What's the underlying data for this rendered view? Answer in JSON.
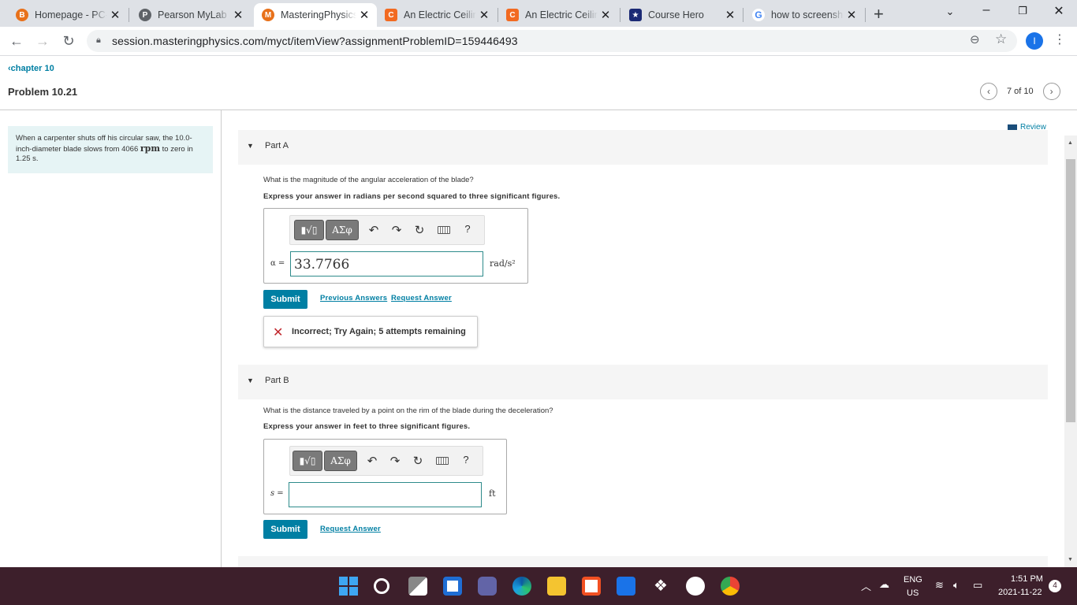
{
  "browser": {
    "tabs": [
      {
        "title": "Homepage - PC-",
        "favicon": "B",
        "favicon_color": "#e8711a",
        "active": false
      },
      {
        "title": "Pearson MyLab a",
        "favicon": "P",
        "favicon_color": "#5f6368",
        "active": false
      },
      {
        "title": "MasteringPhysics",
        "favicon": "M",
        "favicon_color": "#e8711a",
        "active": true
      },
      {
        "title": "An Electric Ceilin",
        "favicon": "C",
        "favicon_color": "#f26a21",
        "active": false
      },
      {
        "title": "An Electric Ceilin",
        "favicon": "C",
        "favicon_color": "#f26a21",
        "active": false
      },
      {
        "title": "Course Hero",
        "favicon": "★",
        "favicon_color": "#1b2a75",
        "active": false
      },
      {
        "title": "how to screensho",
        "favicon": "G",
        "favicon_color": "#4285f4",
        "active": false
      }
    ],
    "url": "session.masteringphysics.com/myct/itemView?assignmentProblemID=159446493",
    "profile_initial": "I"
  },
  "header": {
    "back_link": "chapter 10",
    "problem_title": "Problem 10.21",
    "pager_text": "7 of 10"
  },
  "problem": {
    "text_before": "When a carpenter shuts off his circular saw, the 10.0-inch-diameter blade slows from 4066 ",
    "unit": "rpm",
    "text_after": " to zero in 1.25 s."
  },
  "review_link": "Review",
  "part_a": {
    "label": "Part A",
    "question": "What is the magnitude of the angular acceleration of the blade?",
    "instruction": "Express your answer in radians per second squared to three significant figures.",
    "variable": "α =",
    "answer": "33.7766",
    "unit": "rad/s²",
    "submit": "Submit",
    "previous_answers": "Previous Answers",
    "request_answer": "Request Answer",
    "feedback": "Incorrect; Try Again; 5 attempts remaining",
    "toolbar": {
      "templates": "▮√▯",
      "greek": "ΑΣφ",
      "help": "?"
    }
  },
  "part_b": {
    "label": "Part B",
    "question": "What is the distance traveled by a point on the rim of the blade during the deceleration?",
    "instruction": "Express your answer in feet to three significant figures.",
    "variable": "s =",
    "answer": "",
    "unit": "ft",
    "submit": "Submit",
    "request_answer": "Request Answer",
    "toolbar": {
      "templates": "▮√▯",
      "greek": "ΑΣφ",
      "help": "?"
    }
  },
  "taskbar": {
    "lang": "ENG",
    "region": "US",
    "time": "1:51 PM",
    "date": "2021-11-22",
    "notifications": "4"
  }
}
